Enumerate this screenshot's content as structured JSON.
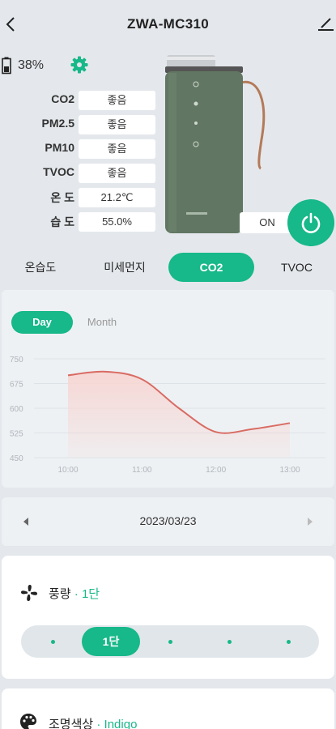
{
  "header": {
    "title": "ZWA-MC310",
    "back_icon": "chevron-left-icon",
    "edit_icon": "pencil-icon"
  },
  "status": {
    "battery": "38%",
    "battery_icon": "battery-icon",
    "settings_icon": "gear-icon"
  },
  "sensors": [
    {
      "label": "CO2",
      "value": "좋음"
    },
    {
      "label": "PM2.5",
      "value": "좋음"
    },
    {
      "label": "PM10",
      "value": "좋음"
    },
    {
      "label": "TVOC",
      "value": "좋음"
    },
    {
      "label": "온 도",
      "value": "21.2℃"
    },
    {
      "label": "습 도",
      "value": "55.0%"
    }
  ],
  "power": {
    "state": "ON",
    "icon": "power-icon"
  },
  "tabs": [
    "온습도",
    "미세먼지",
    "CO2",
    "TVOC"
  ],
  "active_tab": "CO2",
  "period": {
    "day": "Day",
    "month": "Month"
  },
  "chart_data": {
    "type": "area",
    "x": [
      "10:00",
      "11:00",
      "12:00",
      "13:00"
    ],
    "yticks": [
      "750",
      "675",
      "600",
      "525",
      "450"
    ],
    "ylim": [
      450,
      750
    ],
    "series": [
      {
        "x": [
          0,
          0.5,
          1.0,
          1.5,
          2.0,
          2.5,
          3.0
        ],
        "y": [
          700,
          711,
          688,
          600,
          528,
          537,
          555
        ]
      }
    ],
    "grid": true,
    "colors": {
      "line": "#d96b63",
      "fill": "#f7d6d3"
    }
  },
  "date": {
    "value": "2023/03/23",
    "prev_icon": "caret-left-icon",
    "next_icon": "caret-right-icon"
  },
  "fan": {
    "label": "풍량",
    "separator": "·",
    "level": "1단",
    "icon": "fan-icon",
    "slider_value": "1단",
    "slider_steps": 5,
    "slider_position": 1
  },
  "light": {
    "label": "조명색상",
    "separator": "·",
    "color": "Indigo",
    "icon": "palette-icon"
  },
  "theme": {
    "accent": "#17b889"
  }
}
